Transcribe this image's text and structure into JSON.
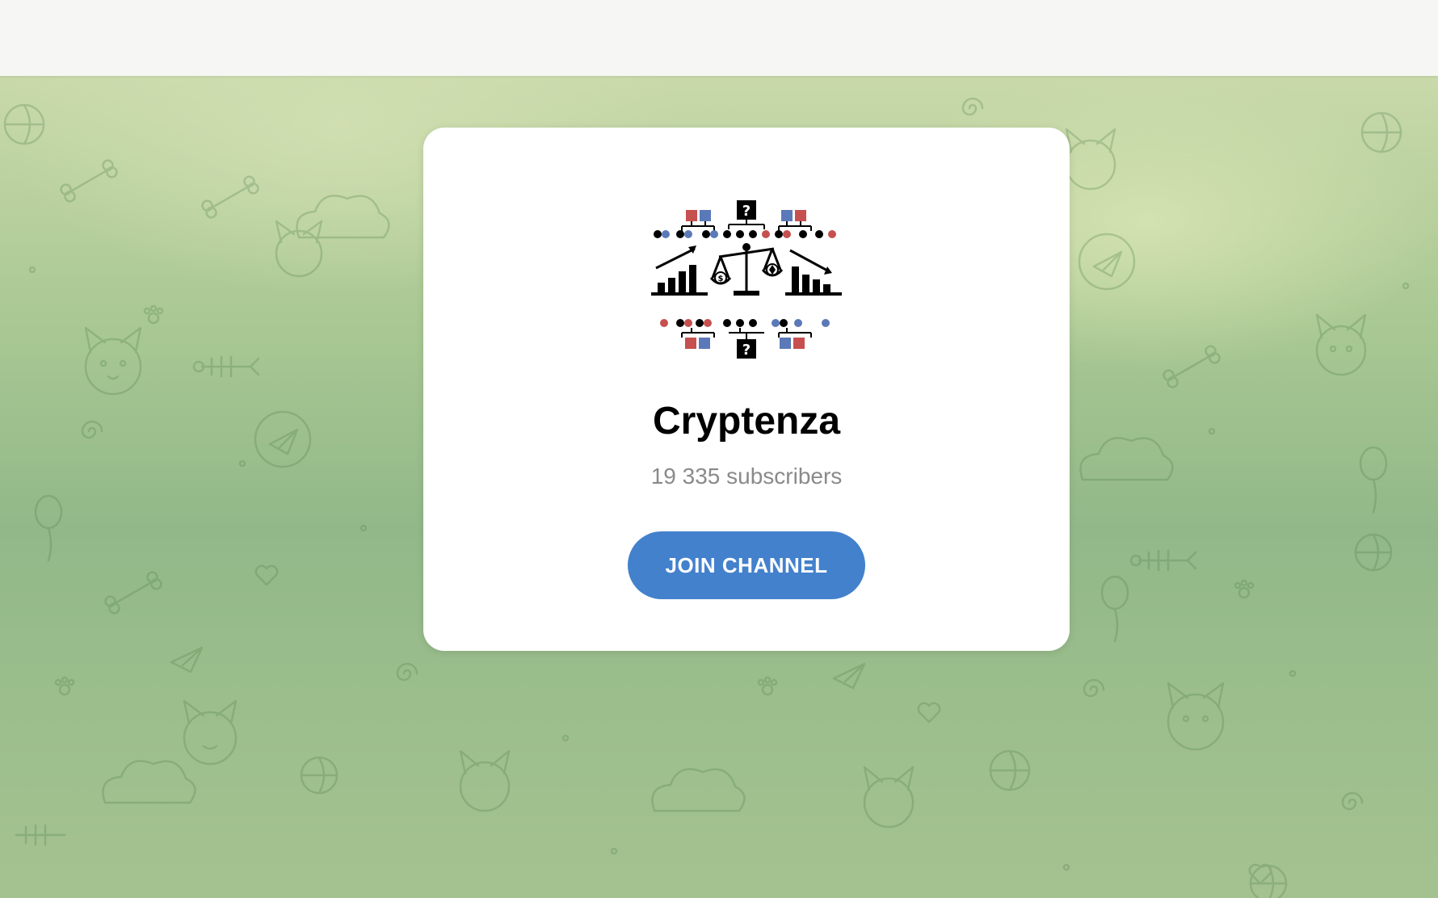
{
  "channel": {
    "name": "Cryptenza",
    "subscribers": "19 335 subscribers",
    "avatar_icon": "crypto-scales-logo-icon"
  },
  "actions": {
    "join_label": "JOIN CHANNEL"
  },
  "colors": {
    "button": "#4381cc",
    "background_green": "#a9c893",
    "card": "#ffffff",
    "subtitle": "#8a8a8a",
    "logo_red": "#c6504f",
    "logo_blue": "#5b79b8"
  }
}
